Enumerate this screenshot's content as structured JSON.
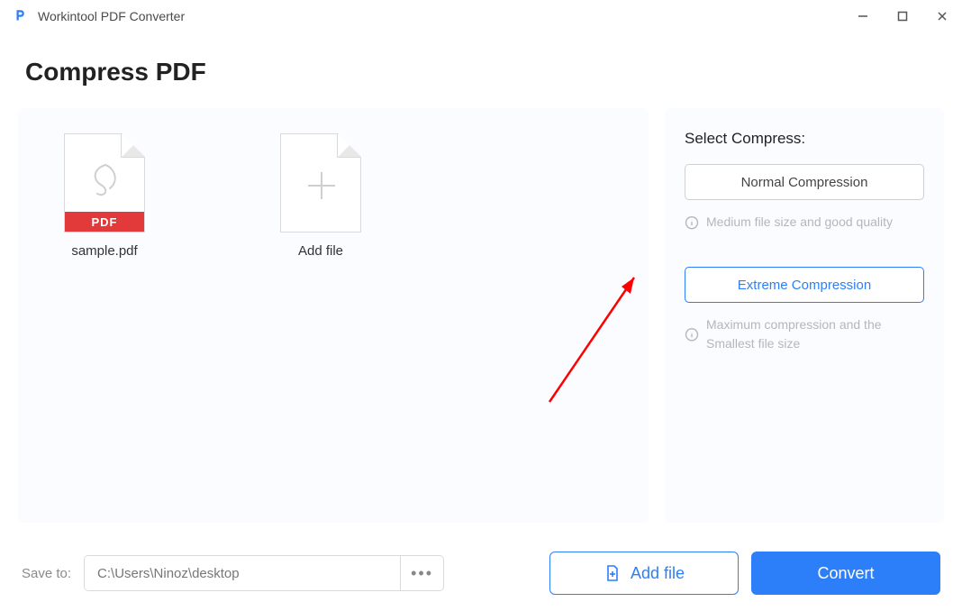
{
  "window": {
    "title": "Workintool PDF Converter"
  },
  "page": {
    "heading": "Compress PDF"
  },
  "files": {
    "sample_name": "sample.pdf",
    "sample_badge": "PDF",
    "add_tile_label": "Add file"
  },
  "options": {
    "heading": "Select Compress:",
    "normal_label": "Normal Compression",
    "normal_desc": "Medium file size and good quality",
    "extreme_label": "Extreme Compression",
    "extreme_desc": "Maximum compression and the Smallest file size"
  },
  "footer": {
    "save_label": "Save to:",
    "save_path": "C:\\Users\\Ninoz\\desktop",
    "addfile_label": "Add file",
    "convert_label": "Convert"
  }
}
